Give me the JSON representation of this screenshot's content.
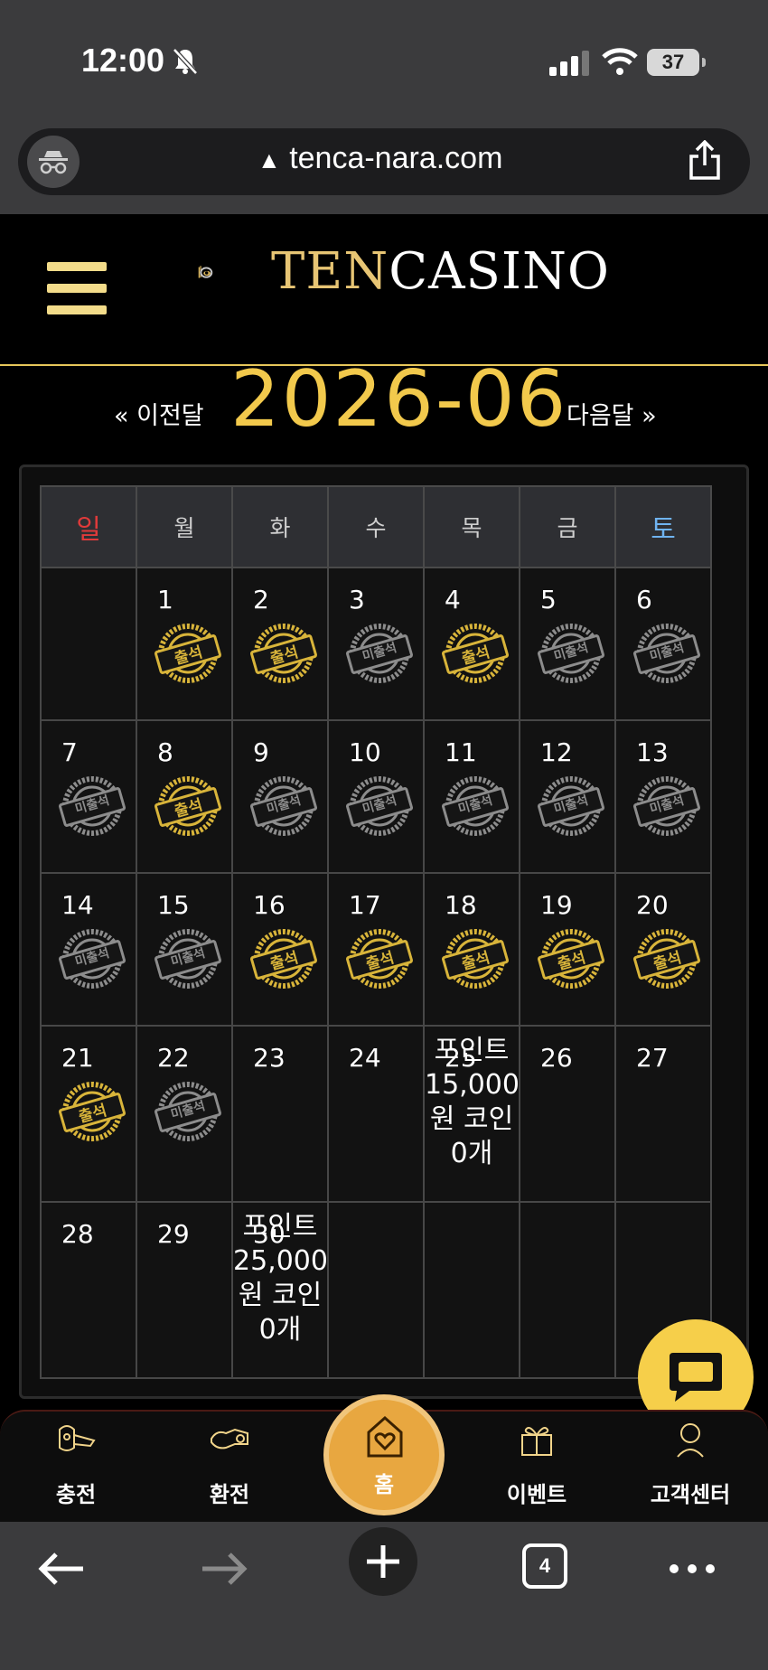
{
  "status": {
    "time": "12:00",
    "battery": "37"
  },
  "browser": {
    "url": "tenca-nara.com",
    "tab_count": "4"
  },
  "site": {
    "logo_ten": "TEN",
    "logo_casino": "CASINO"
  },
  "calendar": {
    "prev_label": "« 이전달",
    "next_label": "다음달 »",
    "month": "2026-06",
    "weekdays": [
      "일",
      "월",
      "화",
      "수",
      "목",
      "금",
      "토"
    ],
    "stamp_attended": "출석",
    "stamp_missed": "미출석",
    "days": [
      {
        "d": "1",
        "s": "출석"
      },
      {
        "d": "2",
        "s": "출석"
      },
      {
        "d": "3",
        "s": "미출석"
      },
      {
        "d": "4",
        "s": "출석"
      },
      {
        "d": "5",
        "s": "미출석"
      },
      {
        "d": "6",
        "s": "미출석"
      },
      {
        "d": "7",
        "s": "미출석"
      },
      {
        "d": "8",
        "s": "출석"
      },
      {
        "d": "9",
        "s": "미출석"
      },
      {
        "d": "10",
        "s": "미출석"
      },
      {
        "d": "11",
        "s": "미출석"
      },
      {
        "d": "12",
        "s": "미출석"
      },
      {
        "d": "13",
        "s": "미출석"
      },
      {
        "d": "14",
        "s": "미출석"
      },
      {
        "d": "15",
        "s": "미출석"
      },
      {
        "d": "16",
        "s": "출석"
      },
      {
        "d": "17",
        "s": "출석"
      },
      {
        "d": "18",
        "s": "출석"
      },
      {
        "d": "19",
        "s": "출석"
      },
      {
        "d": "20",
        "s": "출석"
      },
      {
        "d": "21",
        "s": "출석"
      },
      {
        "d": "22",
        "s": "미출석"
      }
    ],
    "rewards": {
      "day25": "포인트 15,000원 코인0개",
      "day30": "포인트 25,000원 코인0개"
    }
  },
  "nav": {
    "charge": "충전",
    "exchange": "환전",
    "home": "홈",
    "event": "이벤트",
    "support": "고객센터"
  },
  "colors": {
    "gold": "#f2c94c",
    "stamp_gold": "#d8b43a",
    "stamp_gray": "#8c8c8c"
  }
}
